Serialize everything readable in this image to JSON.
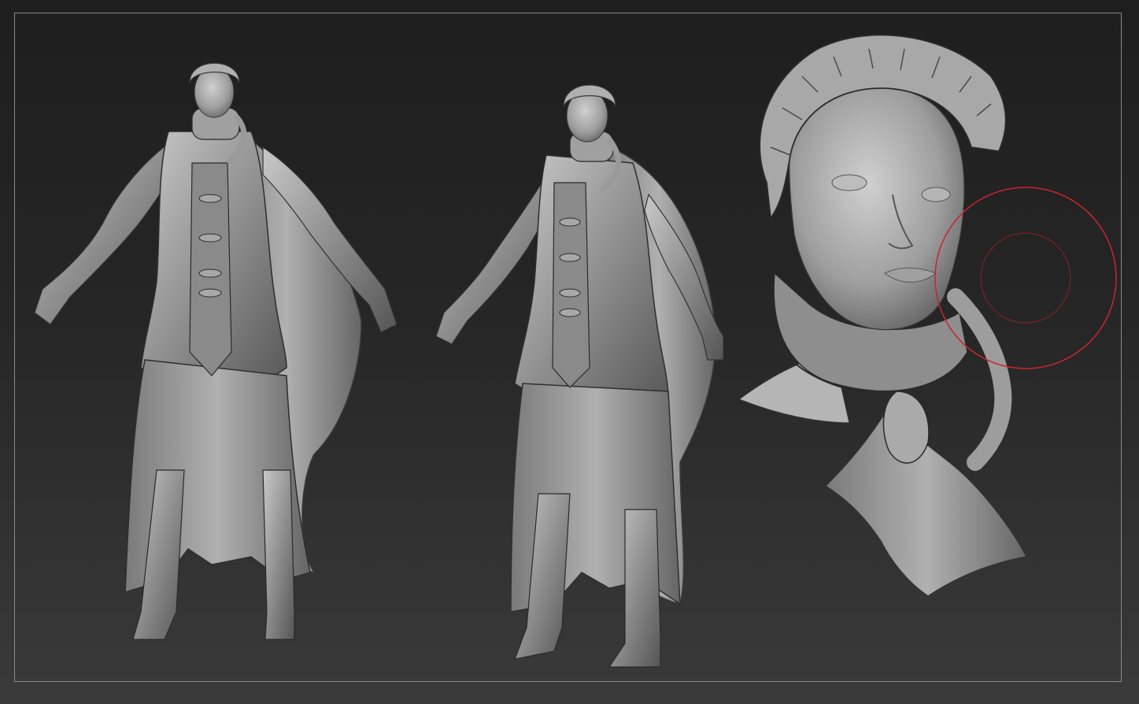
{
  "app": {
    "canvas_background": [
      "#1e1e1e",
      "#3a3a3a"
    ],
    "frame_color": "#8a8a8a",
    "sculpt_material": "#9a9a9a",
    "brush_cursor_color": "#c8262a"
  },
  "models": [
    {
      "name": "figure-front",
      "view": "front"
    },
    {
      "name": "figure-three-quarter",
      "view": "three-quarter"
    },
    {
      "name": "head-closeup",
      "view": "closeup"
    }
  ],
  "brush_cursor": {
    "icon": "brush-draw-size-circle",
    "inner_icon": "brush-focal-shift-circle"
  }
}
